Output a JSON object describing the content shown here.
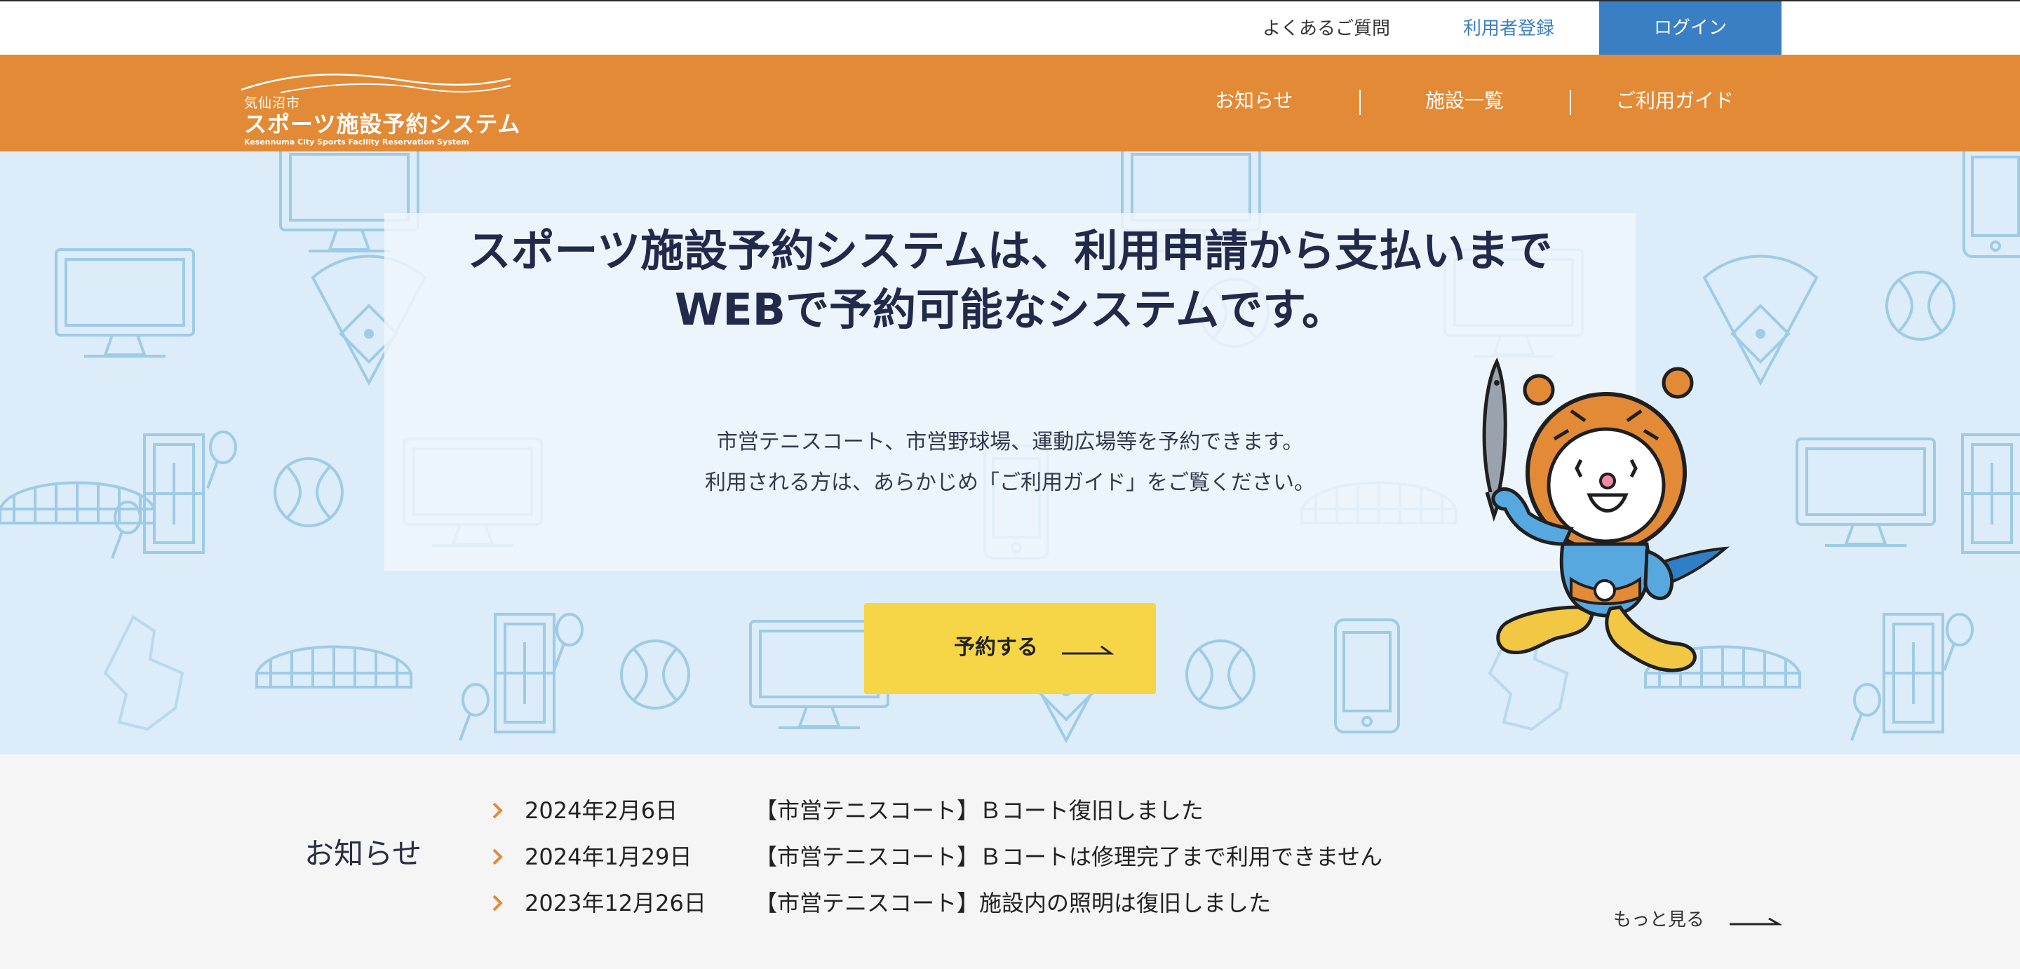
{
  "utility": {
    "faq_label": "よくあるご質問",
    "register_label": "利用者登録",
    "login_label": "ログイン"
  },
  "header": {
    "logo_city": "気仙沼市",
    "logo_name": "スポーツ施設予約システム",
    "logo_sub": "Kesennuma City Sports Facility Reservation System",
    "nav": [
      "お知らせ",
      "施設一覧",
      "ご利用ガイド"
    ]
  },
  "hero": {
    "title_lines": [
      "スポーツ施設予約システムは、利用申請から支払いまで",
      "WEBで予約可能なシステムです。"
    ],
    "desc_lines": [
      "市営テニスコート、市営野球場、運動広場等を予約できます。",
      "利用される方は、あらかじめ「ご利用ガイド」をご覧ください。"
    ],
    "reserve_label": "予約する"
  },
  "news": {
    "heading": "お知らせ",
    "items": [
      {
        "date": "2024年2月6日",
        "title": "【市営テニスコート】Ｂコート復旧しました"
      },
      {
        "date": "2024年1月29日",
        "title": "【市営テニスコート】Ｂコートは修理完了まで利用できません"
      },
      {
        "date": "2023年12月26日",
        "title": "【市営テニスコート】施設内の照明は復旧しました"
      }
    ],
    "more_label": "もっと見る"
  },
  "colors": {
    "header_orange": "#e38a36",
    "login_blue": "#3a7fc4",
    "link_blue": "#3a7fc4",
    "hero_bg": "#dcecf8",
    "reserve_yellow": "#f6d646",
    "news_chevron": "#e38a36"
  },
  "icons": {
    "background_pattern": [
      "monitor-icon",
      "baseball-field-icon",
      "tennis-ball-icon",
      "baseball-icon",
      "tennis-court-icon",
      "tennis-racket-icon",
      "stadium-icon",
      "smartphone-icon",
      "city-map-icon"
    ],
    "reserve_arrow": "arrow-right-icon",
    "news_bullet": "chevron-right-icon",
    "mascot": "mascot-character"
  }
}
